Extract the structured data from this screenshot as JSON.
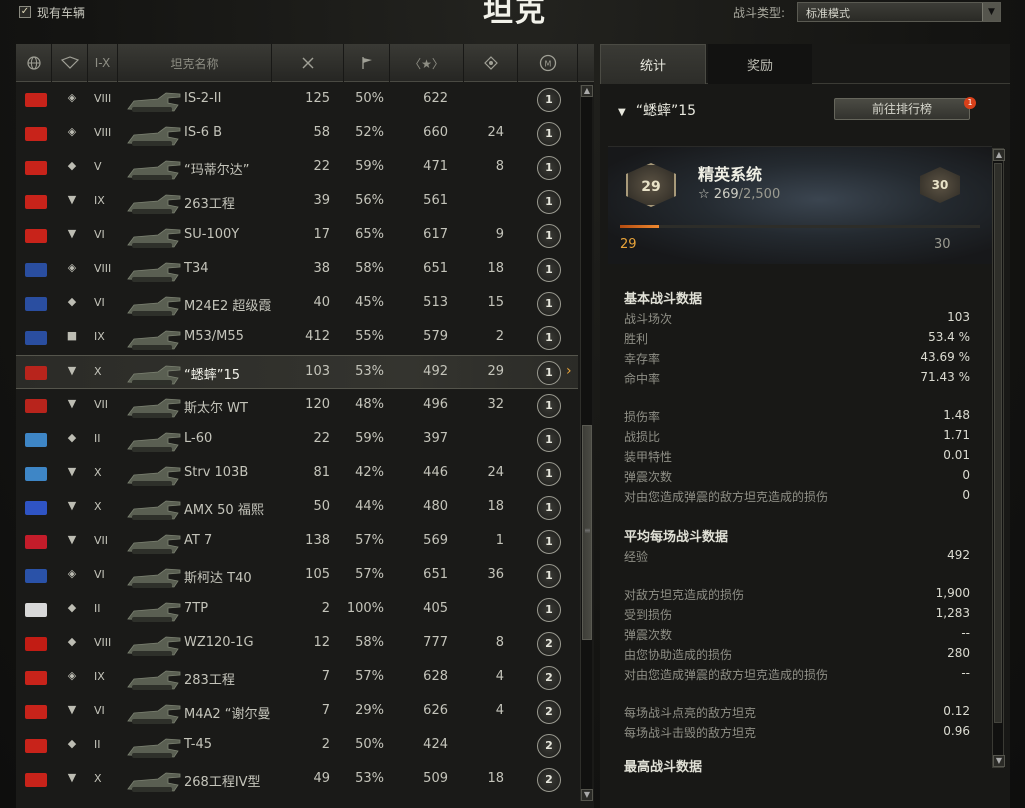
{
  "top": {
    "owned_vehicles_label": "现有车辆",
    "owned_checked_mark": "✓",
    "title": "坦克",
    "battle_type_label": "战斗类型:",
    "battle_type_value": "标准模式"
  },
  "table": {
    "headers": [
      "globe-icon",
      "class-icon",
      "I-X",
      "坦克名称",
      "battles-icon",
      "win-flag-icon",
      "xp-star-icon",
      "damage-icon",
      "mastery-icon"
    ],
    "tier_header": "I-X",
    "name_header": "坦克名称",
    "rows": [
      {
        "nation": "ussr",
        "cls": "◈",
        "tier": "VIII",
        "name": "IS-2-II",
        "battles": "125",
        "wins": "50%",
        "xp": "622",
        "frags": "",
        "mastery": "1"
      },
      {
        "nation": "ussr",
        "cls": "◈",
        "tier": "VIII",
        "name": "IS-6 B",
        "battles": "58",
        "wins": "52%",
        "xp": "660",
        "frags": "24",
        "mastery": "1"
      },
      {
        "nation": "ussr",
        "cls": "◆",
        "tier": "V",
        "name": "“玛蒂尔达”",
        "battles": "22",
        "wins": "59%",
        "xp": "471",
        "frags": "8",
        "mastery": "1"
      },
      {
        "nation": "ussr",
        "cls": "▼",
        "tier": "IX",
        "name": "263工程",
        "battles": "39",
        "wins": "56%",
        "xp": "561",
        "frags": "",
        "mastery": "1"
      },
      {
        "nation": "ussr",
        "cls": "▼",
        "tier": "VI",
        "name": "SU-100Y",
        "battles": "17",
        "wins": "65%",
        "xp": "617",
        "frags": "9",
        "mastery": "1"
      },
      {
        "nation": "usa",
        "cls": "◈",
        "tier": "VIII",
        "name": "T34",
        "battles": "38",
        "wins": "58%",
        "xp": "651",
        "frags": "18",
        "mastery": "1"
      },
      {
        "nation": "usa",
        "cls": "◆",
        "tier": "VI",
        "name": "M24E2 超级霞",
        "battles": "40",
        "wins": "45%",
        "xp": "513",
        "frags": "15",
        "mastery": "1"
      },
      {
        "nation": "usa",
        "cls": "■",
        "tier": "IX",
        "name": "M53/M55",
        "battles": "412",
        "wins": "55%",
        "xp": "579",
        "frags": "2",
        "mastery": "1"
      },
      {
        "nation": "germany",
        "cls": "▼",
        "tier": "X",
        "name": "“蟋蟀”15",
        "battles": "103",
        "wins": "53%",
        "xp": "492",
        "frags": "29",
        "mastery": "1",
        "selected": true
      },
      {
        "nation": "germany",
        "cls": "▼",
        "tier": "VII",
        "name": "斯太尔 WT",
        "battles": "120",
        "wins": "48%",
        "xp": "496",
        "frags": "32",
        "mastery": "1"
      },
      {
        "nation": "sweden",
        "cls": "◆",
        "tier": "II",
        "name": "L-60",
        "battles": "22",
        "wins": "59%",
        "xp": "397",
        "frags": "",
        "mastery": "1"
      },
      {
        "nation": "sweden",
        "cls": "▼",
        "tier": "X",
        "name": "Strv 103B",
        "battles": "81",
        "wins": "42%",
        "xp": "446",
        "frags": "24",
        "mastery": "1"
      },
      {
        "nation": "france",
        "cls": "▼",
        "tier": "X",
        "name": "AMX 50 福熙",
        "battles": "50",
        "wins": "44%",
        "xp": "480",
        "frags": "18",
        "mastery": "1"
      },
      {
        "nation": "uk",
        "cls": "▼",
        "tier": "VII",
        "name": "AT 7",
        "battles": "138",
        "wins": "57%",
        "xp": "569",
        "frags": "1",
        "mastery": "1"
      },
      {
        "nation": "czech",
        "cls": "◈",
        "tier": "VI",
        "name": "斯柯达 T40",
        "battles": "105",
        "wins": "57%",
        "xp": "651",
        "frags": "36",
        "mastery": "1"
      },
      {
        "nation": "poland",
        "cls": "◆",
        "tier": "II",
        "name": "7TP",
        "battles": "2",
        "wins": "100%",
        "xp": "405",
        "frags": "",
        "mastery": "1"
      },
      {
        "nation": "china",
        "cls": "◆",
        "tier": "VIII",
        "name": "WZ120-1G",
        "battles": "12",
        "wins": "58%",
        "xp": "777",
        "frags": "8",
        "mastery": "2"
      },
      {
        "nation": "ussr",
        "cls": "◈",
        "tier": "IX",
        "name": "283工程",
        "battles": "7",
        "wins": "57%",
        "xp": "628",
        "frags": "4",
        "mastery": "2"
      },
      {
        "nation": "ussr",
        "cls": "▼",
        "tier": "VI",
        "name": "M4A2 “谢尔曼",
        "battles": "7",
        "wins": "29%",
        "xp": "626",
        "frags": "4",
        "mastery": "2"
      },
      {
        "nation": "ussr",
        "cls": "◆",
        "tier": "II",
        "name": "T-45",
        "battles": "2",
        "wins": "50%",
        "xp": "424",
        "frags": "",
        "mastery": "2"
      },
      {
        "nation": "ussr",
        "cls": "▼",
        "tier": "X",
        "name": "268工程IV型",
        "battles": "49",
        "wins": "53%",
        "xp": "509",
        "frags": "18",
        "mastery": "2"
      }
    ],
    "selected_arrow": "›"
  },
  "colors": {
    "ussr": "#c8231a",
    "usa": "#2a4ea0",
    "germany": "#b8241c",
    "sweden": "#3e86c6",
    "france": "#2f54c4",
    "uk": "#c41c2a",
    "czech": "#2a52a8",
    "poland": "#d8d8d8",
    "china": "#c21c14",
    "accent": "#e8a33a"
  },
  "right": {
    "tab_stats": "统计",
    "tab_awards": "奖励",
    "vehicle_title": "“蟋蟀”15",
    "leaderboard_button": "前往排行榜",
    "leaderboard_badge": "1",
    "elite": {
      "title": "精英系统",
      "level": "29",
      "next_level": "30",
      "xp_current": "269",
      "xp_total": "/2,500",
      "progress_fraction": 0.108,
      "left_label": "29",
      "right_label": "30"
    },
    "sections": [
      {
        "title": "基本战斗数据",
        "rows": [
          {
            "label": "战斗场次",
            "value": "103"
          },
          {
            "label": "胜利",
            "value": "53.4 %"
          },
          {
            "label": "幸存率",
            "value": "43.69 %"
          },
          {
            "label": "命中率",
            "value": "71.43 %"
          }
        ]
      },
      {
        "title": "",
        "rows": [
          {
            "label": "损伤率",
            "value": "1.48"
          },
          {
            "label": "战损比",
            "value": "1.71"
          },
          {
            "label": "装甲特性",
            "value": "0.01"
          },
          {
            "label": "弹震次数",
            "value": "0"
          },
          {
            "label": "对由您造成弹震的敌方坦克造成的损伤",
            "value": "0"
          }
        ]
      },
      {
        "title": "平均每场战斗数据",
        "rows": [
          {
            "label": "经验",
            "value": "492"
          }
        ]
      },
      {
        "title": "",
        "rows": [
          {
            "label": "对敌方坦克造成的损伤",
            "value": "1,900"
          },
          {
            "label": "受到损伤",
            "value": "1,283"
          },
          {
            "label": "弹震次数",
            "value": "--"
          },
          {
            "label": "由您协助造成的损伤",
            "value": "280"
          },
          {
            "label": "对由您造成弹震的敌方坦克造成的损伤",
            "value": "--"
          }
        ]
      },
      {
        "title": "",
        "rows": [
          {
            "label": "每场战斗点亮的敌方坦克",
            "value": "0.12"
          },
          {
            "label": "每场战斗击毁的敌方坦克",
            "value": "0.96"
          }
        ]
      },
      {
        "title": "最高战斗数据",
        "rows": []
      }
    ]
  }
}
